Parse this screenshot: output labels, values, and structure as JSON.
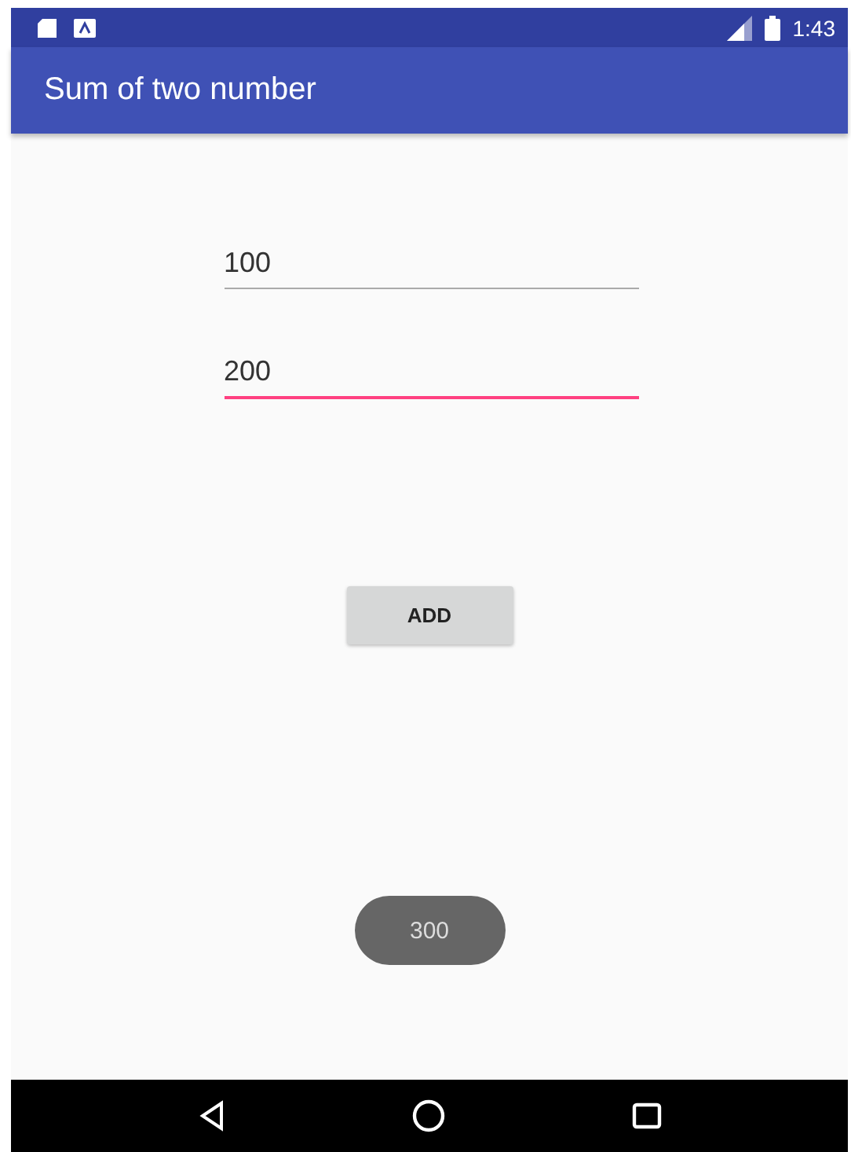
{
  "status_bar": {
    "time": "1:43"
  },
  "app_bar": {
    "title": "Sum of two number"
  },
  "fields": [
    {
      "value": "100",
      "focused": false
    },
    {
      "value": "200",
      "focused": true
    }
  ],
  "button": {
    "label": "ADD"
  },
  "toast": {
    "text": "300"
  }
}
